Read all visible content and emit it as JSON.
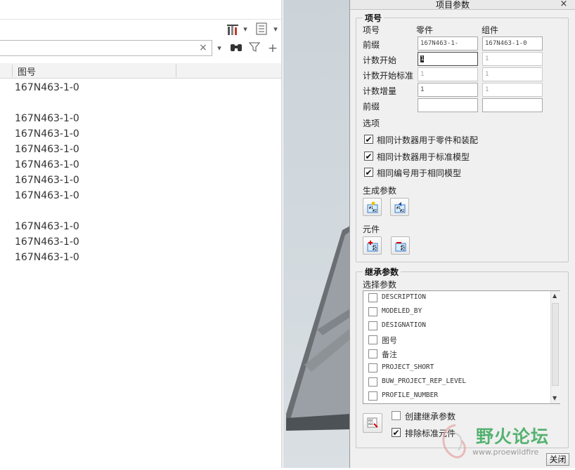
{
  "tree": {
    "column_header": "图号",
    "rows": [
      "167N463-1-0",
      "",
      "167N463-1-0",
      "167N463-1-0",
      "167N463-1-0",
      "167N463-1-0",
      "167N463-1-0",
      "167N463-1-0",
      "",
      "167N463-1-0",
      "167N463-1-0",
      "167N463-1-0"
    ],
    "search_placeholder": "",
    "clear_glyph": "×"
  },
  "dialog": {
    "title": "项目参数",
    "close_glyph": "×",
    "item_group": {
      "title": "项号",
      "col_item": "项号",
      "col_part": "零件",
      "col_assembly": "组件",
      "fields": [
        {
          "label": "前缀",
          "part": "167N463-1-",
          "assembly": "167N463-1-0",
          "part_disabled": false,
          "assembly_disabled": false
        },
        {
          "label": "计数开始",
          "part": "1",
          "assembly": "1",
          "part_disabled": false,
          "assembly_disabled": true
        },
        {
          "label": "计数开始标准",
          "part": "1",
          "assembly": "1",
          "part_disabled": true,
          "assembly_disabled": true
        },
        {
          "label": "计数增量",
          "part": "1",
          "assembly": "1",
          "part_disabled": false,
          "assembly_disabled": true
        },
        {
          "label": "前缀",
          "part": "",
          "assembly": "",
          "part_disabled": false,
          "assembly_disabled": false
        }
      ],
      "options_label": "选项",
      "options": [
        {
          "label": "相同计数器用于零件和装配",
          "checked": true
        },
        {
          "label": "相同计数器用于标准模型",
          "checked": true
        },
        {
          "label": "相同编号用于相同模型",
          "checked": true
        }
      ],
      "generate_label": "生成参数",
      "component_label": "元件"
    },
    "inherit_group": {
      "title": "继承参数",
      "select_label": "选择参数",
      "params": [
        "DESCRIPTION",
        "MODELED_BY",
        "DESIGNATION",
        "图号",
        "备注",
        "PROJECT_SHORT",
        "BUW_PROJECT_REP_LEVEL",
        "PROFILE_NUMBER"
      ],
      "create_inherit": {
        "label": "创建继承参数",
        "checked": false
      },
      "exclude_std": {
        "label": "排除标准元件",
        "checked": true
      }
    },
    "close_button": "关闭"
  },
  "watermark": {
    "text": "野火论坛",
    "url": "www.proewildfire"
  },
  "colors": {
    "accent": "#2a8cff",
    "watermark": "#3aa85a"
  }
}
